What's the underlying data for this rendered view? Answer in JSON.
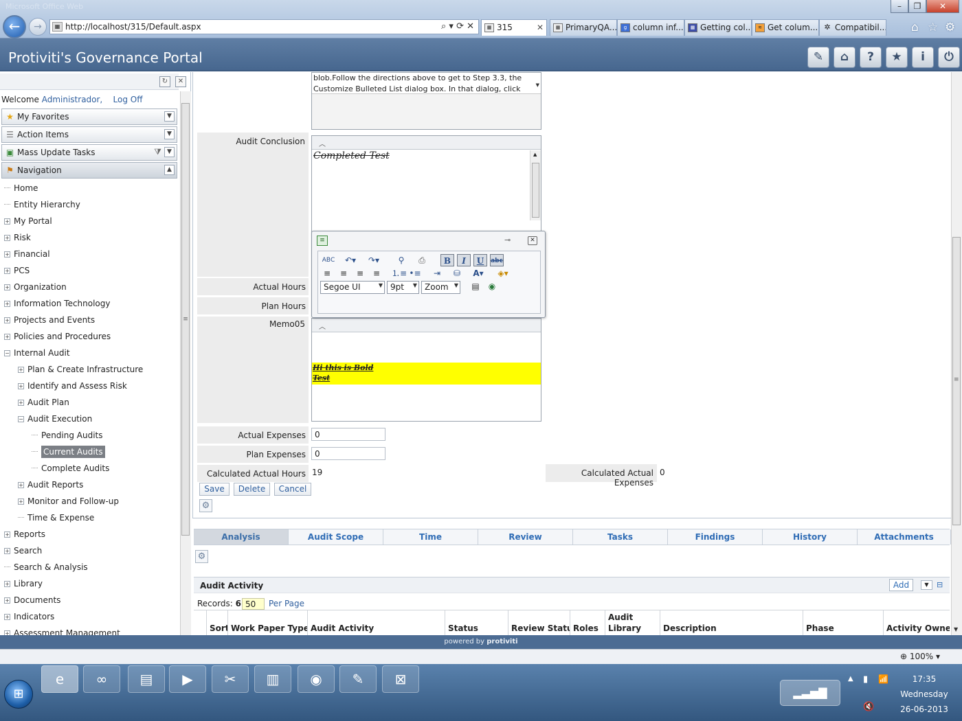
{
  "browser": {
    "window_title": "Microsoft Office Web",
    "url": "http://localhost/315/Default.aspx",
    "tabs": [
      {
        "label": "315",
        "active": true
      },
      {
        "label": "PrimaryQA..."
      },
      {
        "label": "column inf..."
      },
      {
        "label": "Getting col..."
      },
      {
        "label": "Get colum..."
      },
      {
        "label": "Compatibil..."
      }
    ]
  },
  "app": {
    "title": "Protiviti's Governance Portal",
    "header_icons": [
      "plugin-icon",
      "home-icon",
      "help-icon",
      "favorites-icon",
      "info-icon",
      "power-icon"
    ]
  },
  "left_panel": {
    "welcome_text": "Welcome",
    "user_name": "Administrador,",
    "log_off": "Log Off",
    "accordions": [
      {
        "label": "My Favorites",
        "icon": "star-icon"
      },
      {
        "label": "Action Items",
        "icon": "list-icon"
      },
      {
        "label": "Mass Update Tasks",
        "icon": "tasks-icon"
      },
      {
        "label": "Navigation",
        "icon": "signpost-icon"
      }
    ],
    "tree": [
      {
        "label": "Home",
        "level": 0,
        "expand": "none"
      },
      {
        "label": "Entity Hierarchy",
        "level": 0,
        "expand": "none"
      },
      {
        "label": "My Portal",
        "level": 0,
        "expand": "plus"
      },
      {
        "label": "Risk",
        "level": 0,
        "expand": "plus"
      },
      {
        "label": "Financial",
        "level": 0,
        "expand": "plus"
      },
      {
        "label": "PCS",
        "level": 0,
        "expand": "plus"
      },
      {
        "label": "Organization",
        "level": 0,
        "expand": "plus"
      },
      {
        "label": "Information Technology",
        "level": 0,
        "expand": "plus"
      },
      {
        "label": "Projects and Events",
        "level": 0,
        "expand": "plus"
      },
      {
        "label": "Policies and Procedures",
        "level": 0,
        "expand": "plus"
      },
      {
        "label": "Internal Audit",
        "level": 0,
        "expand": "minus"
      },
      {
        "label": "Plan & Create Infrastructure",
        "level": 1,
        "expand": "plus"
      },
      {
        "label": "Identify and Assess Risk",
        "level": 1,
        "expand": "plus"
      },
      {
        "label": "Audit Plan",
        "level": 1,
        "expand": "plus"
      },
      {
        "label": "Audit Execution",
        "level": 1,
        "expand": "minus"
      },
      {
        "label": "Pending Audits",
        "level": 2,
        "expand": "none"
      },
      {
        "label": "Current Audits",
        "level": 2,
        "expand": "none",
        "selected": true
      },
      {
        "label": "Complete Audits",
        "level": 2,
        "expand": "none"
      },
      {
        "label": "Audit Reports",
        "level": 1,
        "expand": "plus"
      },
      {
        "label": "Monitor and Follow-up",
        "level": 1,
        "expand": "plus"
      },
      {
        "label": "Time & Expense",
        "level": 1,
        "expand": "none"
      },
      {
        "label": "Reports",
        "level": 0,
        "expand": "plus"
      },
      {
        "label": "Search",
        "level": 0,
        "expand": "plus"
      },
      {
        "label": "Search & Analysis",
        "level": 0,
        "expand": "none"
      },
      {
        "label": "Library",
        "level": 0,
        "expand": "plus"
      },
      {
        "label": "Documents",
        "level": 0,
        "expand": "plus"
      },
      {
        "label": "Indicators",
        "level": 0,
        "expand": "plus"
      },
      {
        "label": "Assessment Management",
        "level": 0,
        "expand": "plus"
      }
    ]
  },
  "form": {
    "top_memo_text": "blob.Follow the directions above to get to Step 3.3, the Customize Bulleted List dialog box. In that dialog, click",
    "audit_conclusion_label": "Audit Conclusion",
    "audit_conclusion_text": "Completed Test",
    "actual_hours_label": "Actual Hours",
    "plan_hours_label": "Plan Hours",
    "memo05_label": "Memo05",
    "memo05_line1": "Hi this is Bold",
    "memo05_line2": "Test",
    "actual_expenses_label": "Actual Expenses",
    "actual_expenses_value": "0",
    "plan_expenses_label": "Plan Expenses",
    "plan_expenses_value": "0",
    "calc_actual_hours_label": "Calculated Actual Hours",
    "calc_actual_hours_value": "19",
    "calc_actual_expenses_label": "Calculated Actual Expenses",
    "calc_actual_expenses_value": "0",
    "buttons": {
      "save": "Save",
      "delete": "Delete",
      "cancel": "Cancel"
    }
  },
  "format_toolbar": {
    "font": "Segoe UI",
    "size": "9pt",
    "zoom": "Zoom",
    "bold": "B",
    "italic": "I",
    "underline": "U",
    "strike": "abc",
    "spell": "ABC"
  },
  "tabs": [
    "Analysis",
    "Audit Scope",
    "Time",
    "Review",
    "Tasks",
    "Findings",
    "History",
    "Attachments"
  ],
  "audit_activity": {
    "title": "Audit Activity",
    "add_label": "Add",
    "records_label": "Records:",
    "records_count": "6",
    "per_page_value": "50",
    "per_page_label": "Per Page",
    "columns": [
      "Sort",
      "Work Paper Type",
      "Audit Activity",
      "Status",
      "Review Status",
      "Roles",
      "Audit Library",
      "Description",
      "Phase",
      "Activity Owner"
    ]
  },
  "footer": {
    "powered_by": "powered by",
    "brand": "protiviti"
  },
  "statusbar": {
    "zoom": "100%"
  },
  "taskbar": {
    "time": "17:35",
    "day": "Wednesday",
    "date": "26-06-2013"
  }
}
